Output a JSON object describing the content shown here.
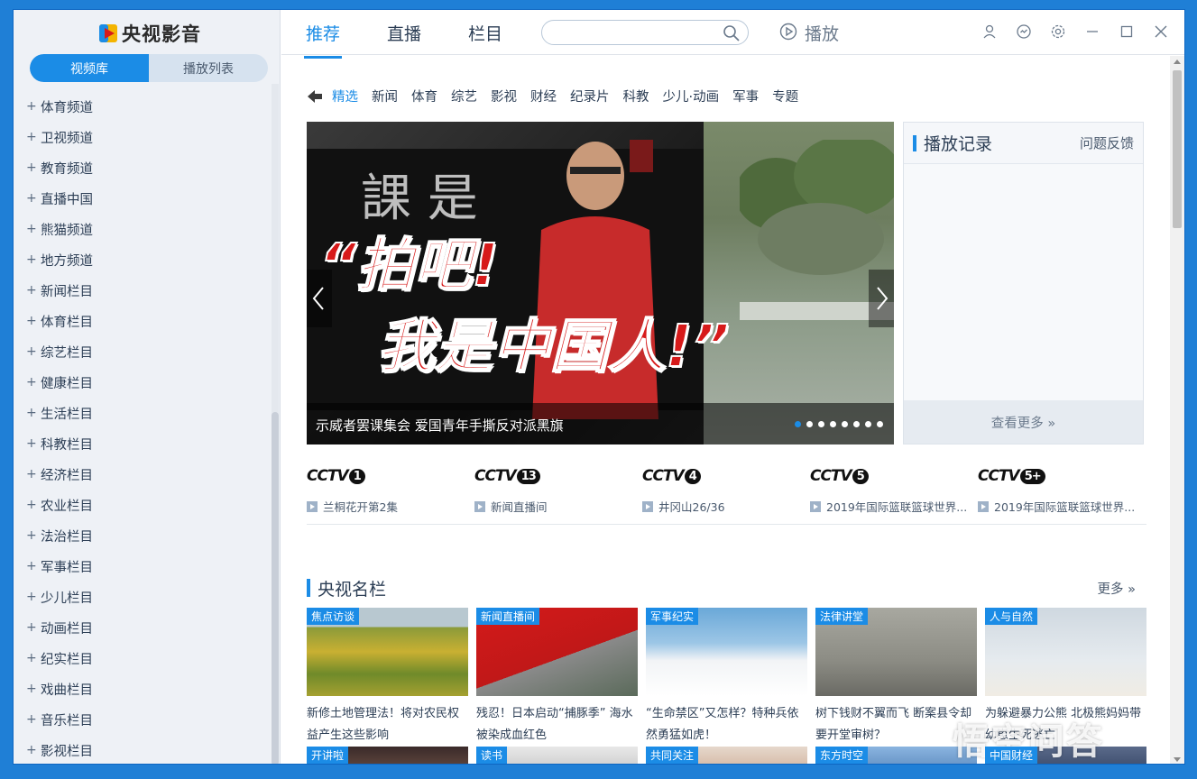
{
  "app": {
    "logo_text": "央视影音"
  },
  "sidebar": {
    "tabs": [
      {
        "label": "视频库",
        "active": true
      },
      {
        "label": "播放列表",
        "active": false
      }
    ],
    "items": [
      {
        "label": "体育频道"
      },
      {
        "label": "卫视频道"
      },
      {
        "label": "教育频道"
      },
      {
        "label": "直播中国"
      },
      {
        "label": "熊猫频道"
      },
      {
        "label": "地方频道"
      },
      {
        "label": "新闻栏目"
      },
      {
        "label": "体育栏目"
      },
      {
        "label": "综艺栏目"
      },
      {
        "label": "健康栏目"
      },
      {
        "label": "生活栏目"
      },
      {
        "label": "科教栏目"
      },
      {
        "label": "经济栏目"
      },
      {
        "label": "农业栏目"
      },
      {
        "label": "法治栏目"
      },
      {
        "label": "军事栏目"
      },
      {
        "label": "少儿栏目"
      },
      {
        "label": "动画栏目"
      },
      {
        "label": "纪实栏目"
      },
      {
        "label": "戏曲栏目"
      },
      {
        "label": "音乐栏目"
      },
      {
        "label": "影视栏目"
      }
    ]
  },
  "header": {
    "tabs": [
      {
        "label": "推荐",
        "active": true
      },
      {
        "label": "直播",
        "active": false
      },
      {
        "label": "栏目",
        "active": false
      }
    ],
    "search": {
      "placeholder": "",
      "value": ""
    },
    "play_label": "播放"
  },
  "categories": [
    {
      "label": "精选",
      "active": true
    },
    {
      "label": "新闻"
    },
    {
      "label": "体育"
    },
    {
      "label": "综艺"
    },
    {
      "label": "影视"
    },
    {
      "label": "财经"
    },
    {
      "label": "纪录片"
    },
    {
      "label": "科教"
    },
    {
      "label": "少儿·动画"
    },
    {
      "label": "军事"
    },
    {
      "label": "专题"
    }
  ],
  "banner": {
    "overlay_line1": "“拍吧!",
    "overlay_line2": "我是中国人!”",
    "sign_text": "課 是",
    "caption": "示威者罢课集会 爱国青年手撕反对派黑旗",
    "dot_count": 8,
    "active_dot": 0
  },
  "history": {
    "title": "播放记录",
    "feedback": "问题反馈",
    "more": "查看更多 »"
  },
  "channels": [
    {
      "logo": "CCTV",
      "num": "1",
      "program": "兰桐花开第2集"
    },
    {
      "logo": "CCTV",
      "num": "13",
      "program": "新闻直播间"
    },
    {
      "logo": "CCTV",
      "num": "4",
      "program": "井冈山26/36"
    },
    {
      "logo": "CCTV",
      "num": "5",
      "program": "2019年国际篮联篮球世界..."
    },
    {
      "logo": "CCTV",
      "num": "5+",
      "program": "2019年国际篮联篮球世界..."
    }
  ],
  "section": {
    "title": "央视名栏",
    "more": "更多 »"
  },
  "cards": [
    {
      "tag": "焦点访谈",
      "title": "新修土地管理法！将对农民权益产生这些影响"
    },
    {
      "tag": "新闻直播间",
      "title": "残忍！日本启动“捕豚季” 海水被染成血红色"
    },
    {
      "tag": "军事纪实",
      "title": "“生命禁区”又怎样？特种兵依然勇猛如虎！"
    },
    {
      "tag": "法律讲堂",
      "title": "树下钱财不翼而飞 断案县令却要开堂审树？"
    },
    {
      "tag": "人与自然",
      "title": "为躲避暴力公熊 北极熊妈妈带幼崽生死逃亡"
    }
  ],
  "cards_row2": [
    {
      "tag": "开讲啦"
    },
    {
      "tag": "读书"
    },
    {
      "tag": "共同关注"
    },
    {
      "tag": "东方时空"
    },
    {
      "tag": "中国财经"
    }
  ],
  "watermark": "悟空问答",
  "colors": {
    "accent": "#1b8ce6",
    "frame": "#1f7fd6"
  }
}
